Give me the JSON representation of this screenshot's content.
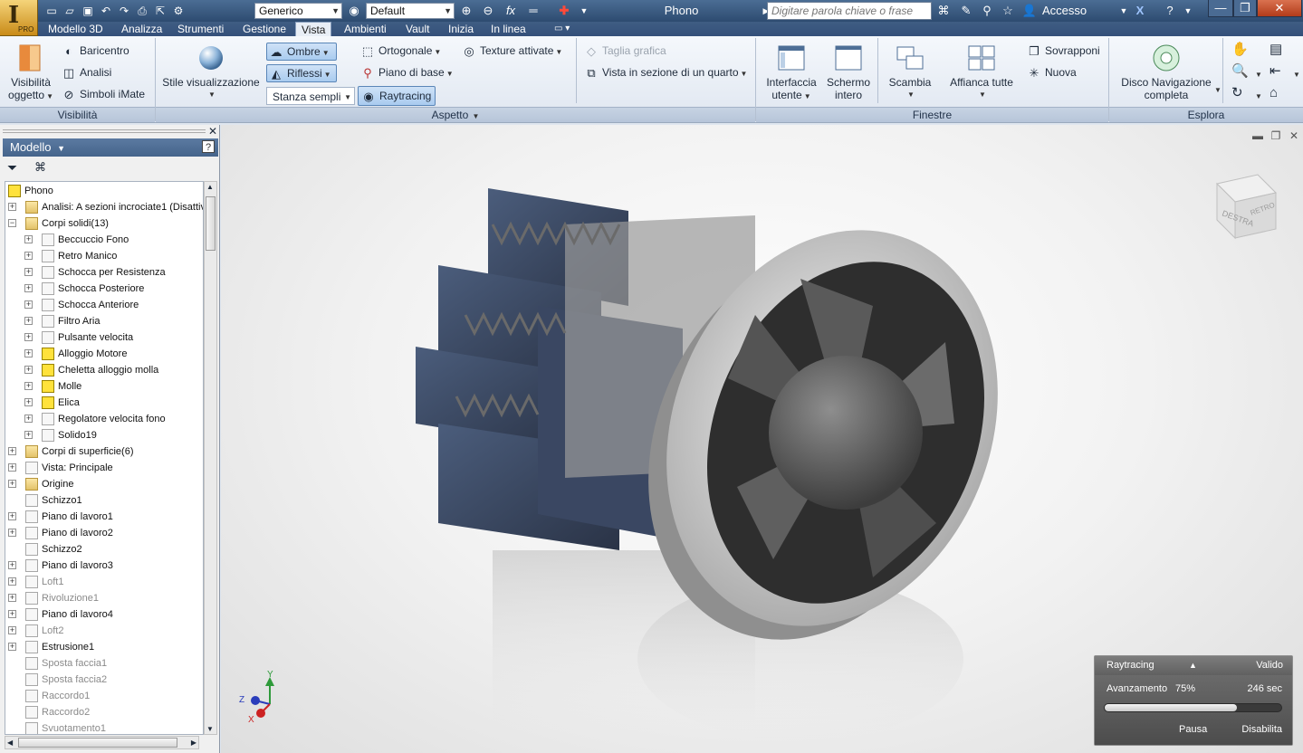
{
  "app": {
    "logo_letter": "I",
    "edition": "PRO",
    "document_title": "Phono"
  },
  "quick_access": {
    "appearance": "Generico",
    "material": "Default",
    "fx": "fx"
  },
  "search": {
    "placeholder": "Digitare parola chiave o frase"
  },
  "account": {
    "label": "Accesso"
  },
  "tabs": [
    {
      "label": "Modello 3D"
    },
    {
      "label": "Analizza"
    },
    {
      "label": "Strumenti"
    },
    {
      "label": "Gestione"
    },
    {
      "label": "Vista",
      "active": true
    },
    {
      "label": "Ambienti"
    },
    {
      "label": "Vault"
    },
    {
      "label": "Inizia"
    },
    {
      "label": "In linea"
    }
  ],
  "ribbon": {
    "visibilita": {
      "footer": "Visibilità",
      "visibilita_oggetto": [
        "Visibilità",
        "oggetto"
      ],
      "baricentro": "Baricentro",
      "analisi": "Analisi",
      "simboli_imate": "Simboli iMate"
    },
    "aspetto": {
      "footer": "Aspetto",
      "stile": "Stile visualizzazione",
      "ombre": "Ombre",
      "riflessi": "Riflessi",
      "stanza": "Stanza sempli",
      "ortogonale": "Ortogonale",
      "piano_base": "Piano di base",
      "raytracing": "Raytracing",
      "texture": "Texture attivate",
      "taglia_grafica": "Taglia grafica",
      "vista_sezione": "Vista in sezione di un quarto"
    },
    "finestre": {
      "footer": "Finestre",
      "interfaccia": [
        "Interfaccia",
        "utente"
      ],
      "schermo": [
        "Schermo",
        "intero"
      ],
      "scambia": "Scambia",
      "affianca": "Affianca tutte",
      "sovrapponi": "Sovrapponi",
      "nuova": "Nuova"
    },
    "esplora": {
      "footer": "Esplora",
      "disco": [
        "Disco Navigazione",
        "completa"
      ]
    }
  },
  "browser": {
    "title": "Modello",
    "tree": [
      {
        "label": "Phono",
        "icon": "part",
        "level": 0,
        "expander": ""
      },
      {
        "label": "Analisi: A sezioni incrociate1 (Disattiv",
        "icon": "folder",
        "level": 1,
        "expander": "+"
      },
      {
        "label": "Corpi solidi(13)",
        "icon": "folder",
        "level": 1,
        "expander": "−"
      },
      {
        "label": "Beccuccio Fono",
        "icon": "body",
        "level": 2,
        "expander": "+"
      },
      {
        "label": "Retro Manico",
        "icon": "body",
        "level": 2,
        "expander": "+"
      },
      {
        "label": "Schocca per Resistenza",
        "icon": "body",
        "level": 2,
        "expander": "+"
      },
      {
        "label": "Schocca Posteriore",
        "icon": "body",
        "level": 2,
        "expander": "+"
      },
      {
        "label": "Schocca Anteriore",
        "icon": "body",
        "level": 2,
        "expander": "+"
      },
      {
        "label": "Filtro Aria",
        "icon": "body",
        "level": 2,
        "expander": "+"
      },
      {
        "label": "Pulsante velocita",
        "icon": "body",
        "level": 2,
        "expander": "+"
      },
      {
        "label": "Alloggio  Motore",
        "icon": "body-yellow",
        "level": 2,
        "expander": "+"
      },
      {
        "label": "Cheletta alloggio molla",
        "icon": "body-yellow",
        "level": 2,
        "expander": "+"
      },
      {
        "label": "Molle",
        "icon": "body-yellow",
        "level": 2,
        "expander": "+"
      },
      {
        "label": "Elica",
        "icon": "body-yellow",
        "level": 2,
        "expander": "+"
      },
      {
        "label": "Regolatore velocita fono",
        "icon": "body",
        "level": 2,
        "expander": "+"
      },
      {
        "label": "Solido19",
        "icon": "body",
        "level": 2,
        "expander": "+"
      },
      {
        "label": "Corpi di superficie(6)",
        "icon": "folder",
        "level": 1,
        "expander": "+"
      },
      {
        "label": "Vista: Principale",
        "icon": "view",
        "level": 1,
        "expander": "+"
      },
      {
        "label": "Origine",
        "icon": "folder",
        "level": 1,
        "expander": "+"
      },
      {
        "label": "Schizzo1",
        "icon": "sketch",
        "level": 1,
        "expander": ""
      },
      {
        "label": "Piano di lavoro1",
        "icon": "plane",
        "level": 1,
        "expander": "+"
      },
      {
        "label": "Piano di lavoro2",
        "icon": "plane",
        "level": 1,
        "expander": "+"
      },
      {
        "label": "Schizzo2",
        "icon": "sketch",
        "level": 1,
        "expander": ""
      },
      {
        "label": "Piano di lavoro3",
        "icon": "plane",
        "level": 1,
        "expander": "+"
      },
      {
        "label": "Loft1",
        "icon": "feature",
        "level": 1,
        "expander": "+",
        "gray": true
      },
      {
        "label": "Rivoluzione1",
        "icon": "feature",
        "level": 1,
        "expander": "+",
        "gray": true
      },
      {
        "label": "Piano di lavoro4",
        "icon": "plane",
        "level": 1,
        "expander": "+"
      },
      {
        "label": "Loft2",
        "icon": "feature",
        "level": 1,
        "expander": "+",
        "gray": true
      },
      {
        "label": "Estrusione1",
        "icon": "feature",
        "level": 1,
        "expander": "+"
      },
      {
        "label": "Sposta faccia1",
        "icon": "feature",
        "level": 1,
        "expander": "",
        "gray": true
      },
      {
        "label": "Sposta faccia2",
        "icon": "feature",
        "level": 1,
        "expander": "",
        "gray": true
      },
      {
        "label": "Raccordo1",
        "icon": "feature",
        "level": 1,
        "expander": "",
        "gray": true
      },
      {
        "label": "Raccordo2",
        "icon": "feature",
        "level": 1,
        "expander": "",
        "gray": true
      },
      {
        "label": "Svuotamento1",
        "icon": "feature",
        "level": 1,
        "expander": "",
        "gray": true
      }
    ]
  },
  "viewcube": {
    "front": "DESTRA",
    "side": "RETRO"
  },
  "triad": {
    "x": "X",
    "y": "Y",
    "z": "Z"
  },
  "raytracing": {
    "title": "Raytracing",
    "quality": "Valido",
    "progress_label": "Avanzamento",
    "progress_text": "75%",
    "progress": 0.75,
    "time": "246 sec",
    "pause": "Pausa",
    "disable": "Disabilita"
  },
  "colors": {
    "accent": "#3b5c85",
    "active_tab": "#e8eef6",
    "toggle": "#a9cbef"
  }
}
